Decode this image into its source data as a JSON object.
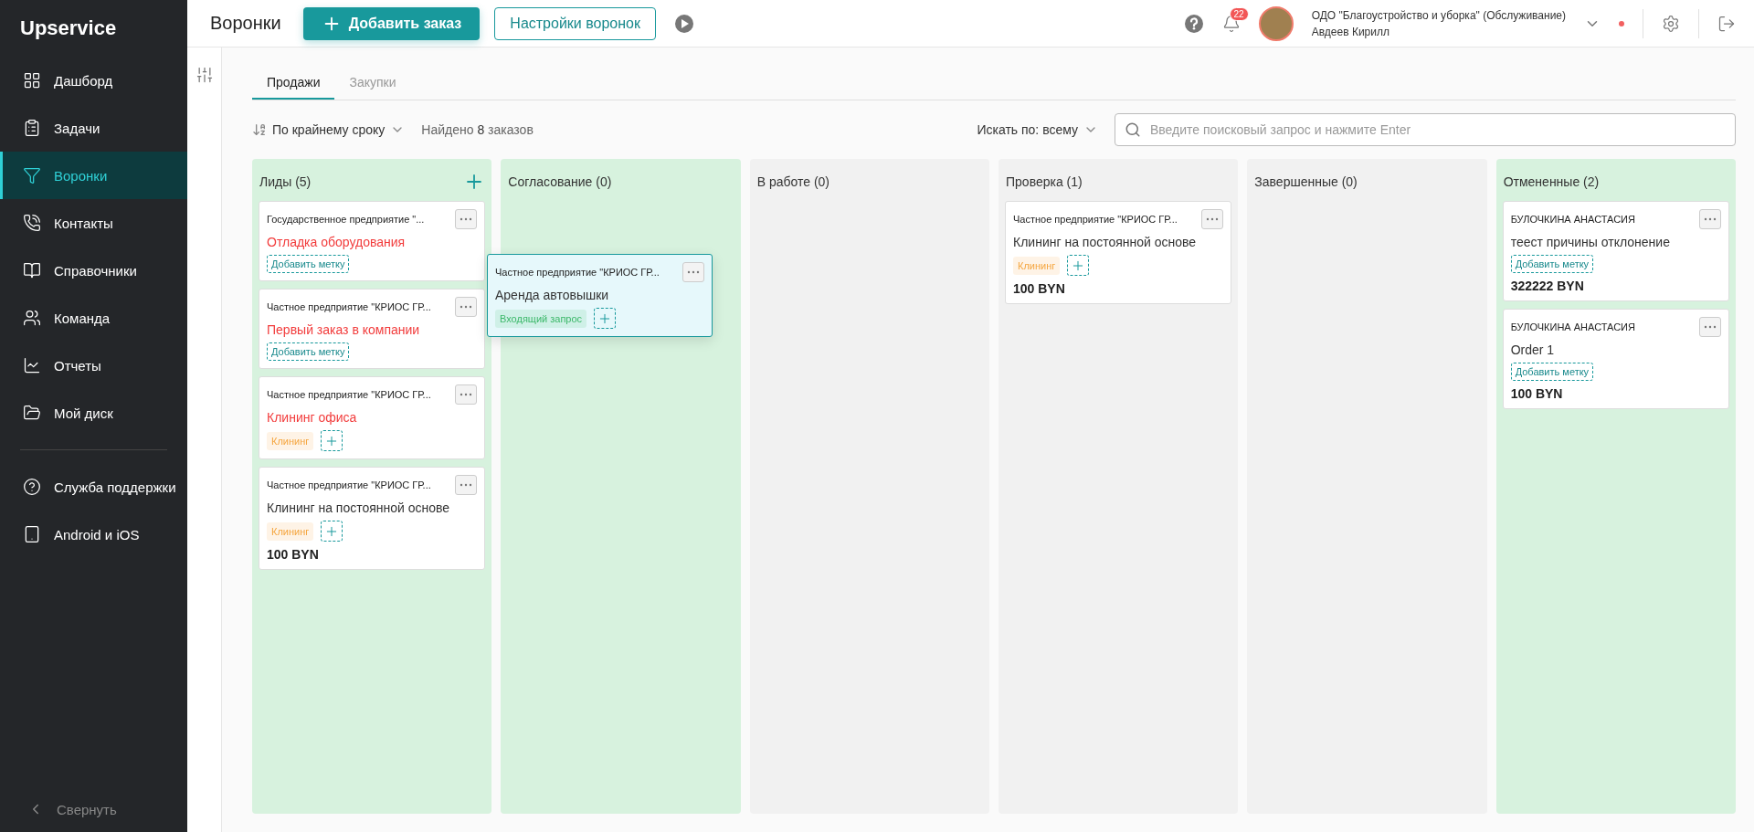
{
  "sidebar": {
    "logo": "Upservice",
    "items": [
      {
        "label": "Дашборд",
        "selected": false
      },
      {
        "label": "Задачи",
        "selected": false
      },
      {
        "label": "Воронки",
        "selected": true
      },
      {
        "label": "Контакты",
        "selected": false
      },
      {
        "label": "Справочники",
        "selected": false
      },
      {
        "label": "Команда",
        "selected": false
      },
      {
        "label": "Отчеты",
        "selected": false
      },
      {
        "label": "Мой диск",
        "selected": false
      }
    ],
    "footer_items": [
      {
        "label": "Служба поддержки",
        "selected": false
      },
      {
        "label": "Android и iOS",
        "selected": false
      }
    ],
    "collapse": "Свернуть"
  },
  "header": {
    "title": "Воронки",
    "add_button": "Добавить заказ",
    "settings_button": "Настройки воронок",
    "notifications_count": "22",
    "company": "ОДО \"Благоустройство и уборка\" (Обслуживание)",
    "user": "Авдеев Кирилл"
  },
  "tabs": [
    {
      "label": "Продажи",
      "selected": true
    },
    {
      "label": "Закупки",
      "selected": false
    }
  ],
  "toolbar": {
    "sort": "По крайнему сроку",
    "found": "Найдено **8** заказов",
    "search_by": "Искать по: всему",
    "search": {
      "placeholder": "Введите поисковый запрос и нажмите Enter"
    }
  },
  "columns": [
    {
      "title": "Лиды (5)",
      "highlighted": true,
      "can_add": true,
      "cards": [
        {
          "client": "Государственное предприятие \"...",
          "title": "Отладка оборудования",
          "overdue": true,
          "add_label": "Добавить метку"
        },
        {
          "client": "Частное предприятие \"КРИОС ГР...",
          "title": "Первый заказ в компании",
          "overdue": true,
          "add_label": "Добавить метку"
        },
        {
          "client": "Частное предприятие \"КРИОС ГР...",
          "title": "Клининг офиса",
          "overdue": true,
          "tags": [
            {
              "label": "Клининг",
              "color": "#f5a640"
            }
          ]
        },
        {
          "client": "Частное предприятие \"КРИОС ГР...",
          "title": "Клининг на постоянной основе",
          "overdue": false,
          "tags": [
            {
              "label": "Клининг",
              "color": "#f5a640"
            }
          ],
          "price": "100 BYN"
        }
      ]
    },
    {
      "title": "Согласование (0)",
      "highlighted": true,
      "can_add": false
    },
    {
      "title": "В работе (0)",
      "highlighted": false,
      "can_add": false
    },
    {
      "title": "Проверка (1)",
      "highlighted": false,
      "can_add": false,
      "cards": [
        {
          "client": "Частное предприятие \"КРИОС ГР...",
          "title": "Клининг на постоянной основе",
          "overdue": false,
          "tags": [
            {
              "label": "Клининг",
              "color": "#f5a640"
            }
          ],
          "price": "100 BYN"
        }
      ]
    },
    {
      "title": "Завершенные (0)",
      "highlighted": false,
      "can_add": false
    },
    {
      "title": "Отмененные (2)",
      "highlighted": true,
      "can_add": false,
      "cards": [
        {
          "client": "БУЛОЧКИНА АНАСТАСИЯ",
          "title": "теест причины отклонение",
          "overdue": false,
          "add_label": "Добавить метку",
          "price": "322222 BYN"
        },
        {
          "client": "БУЛОЧКИНА АНАСТАСИЯ",
          "title": "Order 1",
          "overdue": false,
          "add_label": "Добавить метку",
          "price": "100 BYN"
        }
      ]
    }
  ],
  "dragged_card": {
    "client": "Частное предприятие \"КРИОС ГР...",
    "title": "Аренда автовышки",
    "overdue": false,
    "tags": [
      {
        "label": "Входящий запрос",
        "color": "#3cb86a"
      }
    ]
  }
}
